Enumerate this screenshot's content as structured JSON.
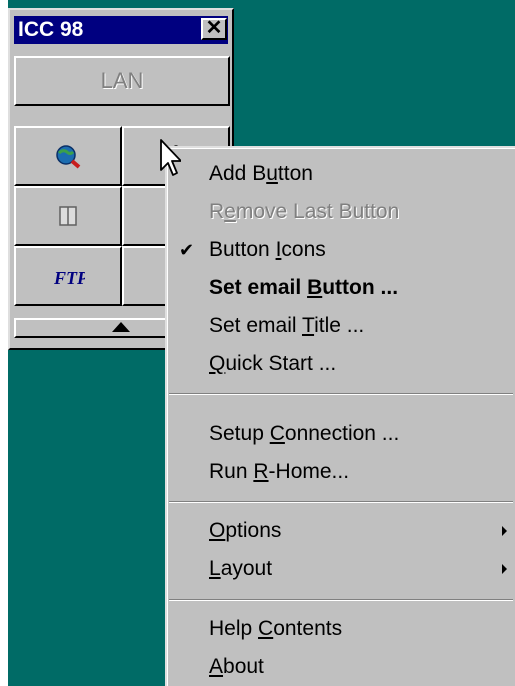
{
  "window": {
    "title": "ICC 98",
    "close_glyph": "✕",
    "lan_label": "LAN",
    "toolbar_buttons": [
      {
        "icon": "globe-search-icon"
      },
      {
        "icon": "mouse-icon"
      },
      {
        "icon": "book-icon"
      },
      {
        "icon": "partial-icon"
      },
      {
        "icon": "ftp-icon"
      },
      {
        "icon": "partial-icon-2"
      }
    ],
    "ftp_text": "FTP"
  },
  "menu": {
    "items": [
      {
        "pre": "Add B",
        "acc": "u",
        "post": "tton",
        "state": "normal"
      },
      {
        "pre": "R",
        "acc": "e",
        "post": "move Last Button",
        "state": "disabled"
      },
      {
        "pre": "Button ",
        "acc": "I",
        "post": "cons",
        "state": "checked",
        "check": "✔"
      },
      {
        "pre": "Set email ",
        "acc": "B",
        "post": "utton ...",
        "state": "bold"
      },
      {
        "pre": "Set email ",
        "acc": "T",
        "post": "itle ...",
        "state": "normal"
      },
      {
        "pre": "",
        "acc": "Q",
        "post": "uick Start ...",
        "state": "normal"
      },
      {
        "pre": "Setup ",
        "acc": "C",
        "post": "onnection ...",
        "state": "normal"
      },
      {
        "pre": "Run ",
        "acc": "R",
        "post": "-Home...",
        "state": "normal"
      },
      {
        "pre": "",
        "acc": "O",
        "post": "ptions",
        "state": "submenu"
      },
      {
        "pre": "",
        "acc": "L",
        "post": "ayout",
        "state": "submenu"
      },
      {
        "pre": "Help ",
        "acc": "C",
        "post": "ontents",
        "state": "normal"
      },
      {
        "pre": "",
        "acc": "A",
        "post": "bout",
        "state": "normal"
      }
    ]
  },
  "colors": {
    "desktop": "#006b66",
    "face": "#c0c0c0",
    "title": "#000080"
  }
}
